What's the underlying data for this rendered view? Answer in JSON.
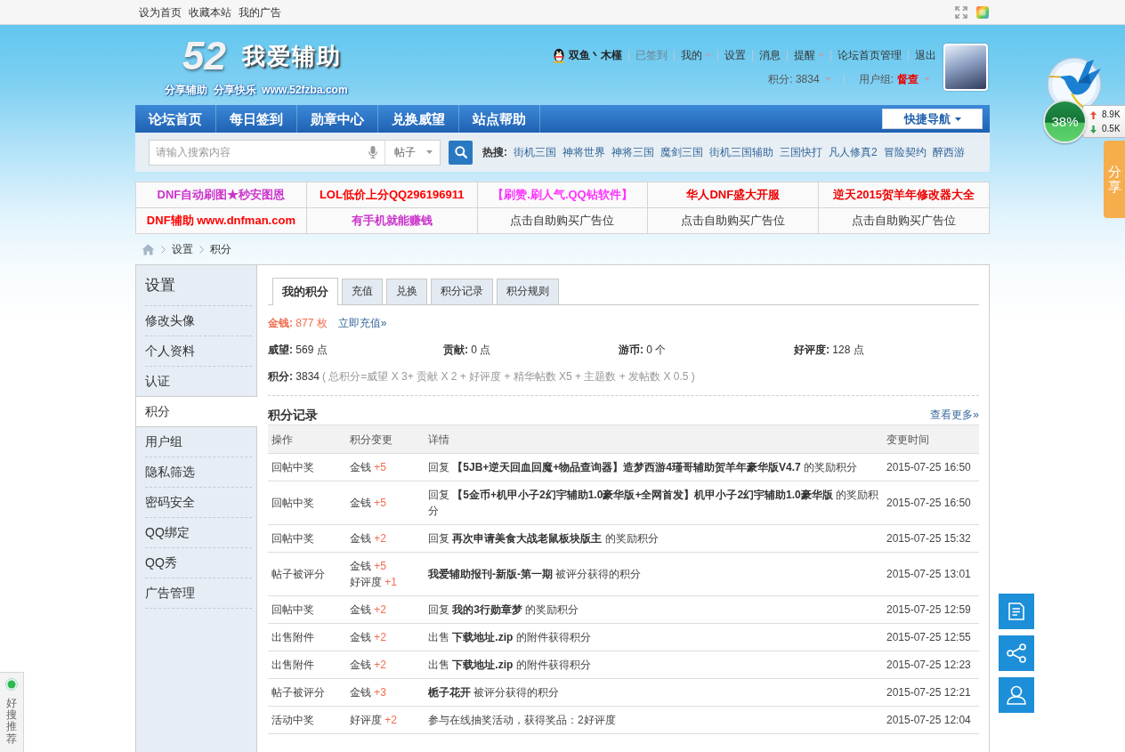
{
  "top_bar": {
    "links": [
      "设为首页",
      "收藏本站",
      "我的广告"
    ]
  },
  "logo": {
    "number": "52",
    "name": "我爱辅助",
    "slogan": "分享辅助  分享快乐  www.52fzba.com"
  },
  "user": {
    "name": "双鱼丶木槿",
    "menu": [
      {
        "label": "已签到",
        "disabled": true,
        "has_menu": false
      },
      {
        "label": "我的",
        "disabled": false,
        "has_menu": true
      },
      {
        "label": "设置",
        "disabled": false,
        "has_menu": false
      },
      {
        "label": "消息",
        "disabled": false,
        "has_menu": false
      },
      {
        "label": "提醒",
        "disabled": false,
        "has_menu": true
      },
      {
        "label": "论坛首页管理",
        "disabled": false,
        "has_menu": false
      },
      {
        "label": "退出",
        "disabled": false,
        "has_menu": false
      }
    ],
    "points": {
      "text": "积分: 3834",
      "has_menu": true
    },
    "group": {
      "label": "用户组:",
      "value": "督查",
      "has_menu": true
    }
  },
  "nav": {
    "items": [
      "论坛首页",
      "每日签到",
      "勋章中心",
      "兑换威望",
      "站点帮助"
    ],
    "quick_nav": "快捷导航"
  },
  "search": {
    "placeholder": "请输入搜索内容",
    "scope": "帖子",
    "hot_label": "热搜:",
    "hot": [
      "街机三国",
      "神将世界",
      "神将三国",
      "魔剑三国",
      "街机三国辅助",
      "三国快打",
      "凡人修真2",
      "冒险契约",
      "醉西游"
    ]
  },
  "ads": [
    {
      "cells": [
        {
          "kind": "ad",
          "text": "DNF自动刷图★秒安图恩",
          "color": "#cc33cc"
        },
        {
          "kind": "ad",
          "text": "LOL低价上分QQ296196911",
          "color": "#ff0000"
        },
        {
          "kind": "ad",
          "text": "【刷赞.刷人气.QQ钻软件】",
          "color": "#ff33ff"
        },
        {
          "kind": "ad",
          "text": "华人DNF盛大开服",
          "color": "#ee0000"
        },
        {
          "kind": "ad",
          "text": "逆天2015贺羊年修改器大全",
          "color": "#ee0000"
        }
      ]
    },
    {
      "cells": [
        {
          "kind": "ad",
          "text": "DNF辅助 www.dnfman.com",
          "color": "#ff0000"
        },
        {
          "kind": "ad",
          "text": "有手机就能赚钱",
          "color": "#cc33cc"
        },
        {
          "kind": "slot",
          "text": "点击自助购买广告位"
        },
        {
          "kind": "slot",
          "text": "点击自助购买广告位"
        },
        {
          "kind": "slot",
          "text": "点击自助购买广告位"
        }
      ]
    }
  ],
  "breadcrumb": [
    "设置",
    "积分"
  ],
  "sidebar": {
    "title": "设置",
    "items": [
      {
        "label": "修改头像",
        "selected": false
      },
      {
        "label": "个人资料",
        "selected": false
      },
      {
        "label": "认证",
        "selected": false
      },
      {
        "label": "积分",
        "selected": true
      },
      {
        "label": "用户组",
        "selected": false
      },
      {
        "label": "隐私筛选",
        "selected": false
      },
      {
        "label": "密码安全",
        "selected": false
      },
      {
        "label": "QQ绑定",
        "selected": false
      },
      {
        "label": "QQ秀",
        "selected": false
      },
      {
        "label": "广告管理",
        "selected": false
      }
    ]
  },
  "tabs": [
    {
      "label": "我的积分",
      "selected": true
    },
    {
      "label": "充值",
      "selected": false
    },
    {
      "label": "兑换",
      "selected": false
    },
    {
      "label": "积分记录",
      "selected": false
    },
    {
      "label": "积分规则",
      "selected": false
    }
  ],
  "money": {
    "text": "**金钱:** 877 枚",
    "link": "立即充值»"
  },
  "stats": [
    "**威望:** 569 点",
    "**贡献:** 0 点",
    "**游币:** 0 个",
    "**好评度:** 128 点"
  ],
  "total": {
    "text": "**积分:** 3834",
    "formula": "( 总积分=威望 X 3+ 贡献 X 2 + 好评度 + 精华帖数 X5 + 主题数 + 发帖数 X 0.5 )"
  },
  "log": {
    "title": "积分记录",
    "more": "查看更多»",
    "columns": [
      "操作",
      "积分变更",
      "详情",
      "变更时间"
    ],
    "rows": [
      {
        "action": "回帖中奖",
        "changes": [
          {
            "label": "金钱",
            "amount": "+5"
          }
        ],
        "detail": "回复 **【5JB+逆天回血回魔+物品查询器】造梦西游4瑾哥辅助贺羊年豪华版V4.7** 的奖励积分",
        "time": "2015-07-25 16:50"
      },
      {
        "action": "回帖中奖",
        "changes": [
          {
            "label": "金钱",
            "amount": "+5"
          }
        ],
        "detail": "回复 **【5金币+机甲小子2幻宇辅助1.0豪华版+全网首发】机甲小子2幻宇辅助1.0豪华版** 的奖励积分",
        "time": "2015-07-25 16:50"
      },
      {
        "action": "回帖中奖",
        "changes": [
          {
            "label": "金钱",
            "amount": "+2"
          }
        ],
        "detail": "回复 **再次申请美食大战老鼠板块版主** 的奖励积分",
        "time": "2015-07-25 15:32"
      },
      {
        "action": "帖子被评分",
        "changes": [
          {
            "label": "金钱",
            "amount": "+5"
          },
          {
            "label": "好评度",
            "amount": "+1"
          }
        ],
        "detail": "**我爱辅助报刊-新版-第一期** 被评分获得的积分",
        "time": "2015-07-25 13:01"
      },
      {
        "action": "回帖中奖",
        "changes": [
          {
            "label": "金钱",
            "amount": "+2"
          }
        ],
        "detail": "回复 **我的3行勋章梦** 的奖励积分",
        "time": "2015-07-25 12:59"
      },
      {
        "action": "出售附件",
        "changes": [
          {
            "label": "金钱",
            "amount": "+2"
          }
        ],
        "detail": "出售 **下载地址.zip** 的附件获得积分",
        "time": "2015-07-25 12:55"
      },
      {
        "action": "出售附件",
        "changes": [
          {
            "label": "金钱",
            "amount": "+2"
          }
        ],
        "detail": "出售 **下载地址.zip** 的附件获得积分",
        "time": "2015-07-25 12:23"
      },
      {
        "action": "帖子被评分",
        "changes": [
          {
            "label": "金钱",
            "amount": "+3"
          }
        ],
        "detail": "**栀子花开** 被评分获得的积分",
        "time": "2015-07-25 12:21"
      },
      {
        "action": "活动中奖",
        "changes": [
          {
            "label": "好评度",
            "amount": "+2"
          }
        ],
        "detail": "参与在线抽奖活动，获得奖品：2好评度",
        "time": "2015-07-25 12:04"
      }
    ]
  },
  "download_widget": {
    "percent": "38%",
    "up": "8.9K",
    "down": "0.5K"
  },
  "share_tab": "分享",
  "recommend": "好搜推荐"
}
